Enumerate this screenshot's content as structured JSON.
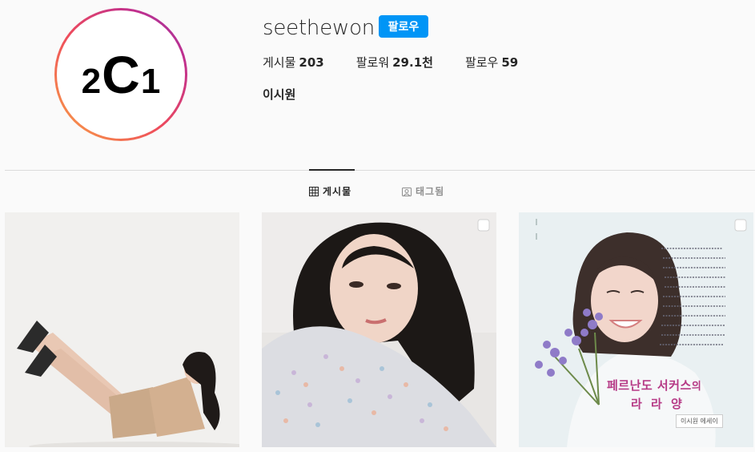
{
  "profile": {
    "avatar_logo": {
      "left": "2",
      "center": "C",
      "right": "1"
    },
    "username": "seethewon",
    "follow_label": "팔로우",
    "stats": [
      {
        "label": "게시물",
        "value": "203"
      },
      {
        "label": "팔로워",
        "value": "29.1천"
      },
      {
        "label": "팔로우",
        "value": "59"
      }
    ],
    "full_name": "이시원"
  },
  "tabs": [
    {
      "label": "게시물",
      "icon": "grid-icon",
      "active": true
    },
    {
      "label": "태그됨",
      "icon": "tagged-icon",
      "active": false
    }
  ],
  "posts": [
    {
      "type": "photo",
      "multi": false
    },
    {
      "type": "photo",
      "multi": true
    },
    {
      "type": "book-cover",
      "multi": true,
      "title_main": "페르난도 서커스",
      "title_particle": "의",
      "subtitle": "라 라 양",
      "author": "이시원 에세이"
    }
  ],
  "colors": {
    "follow_button": "#0095f6",
    "text": "#262626",
    "muted": "#8e8e8e",
    "divider": "#dbdbdb",
    "book_title": "#b63a86"
  }
}
